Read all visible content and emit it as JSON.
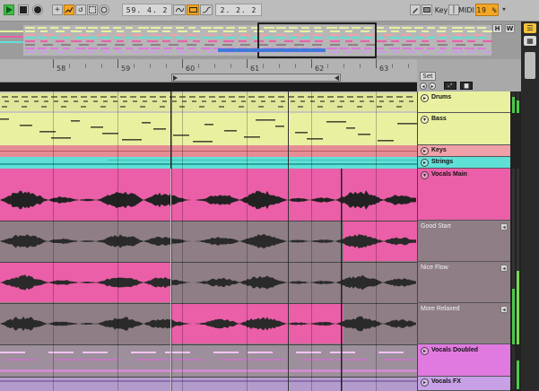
{
  "transport": {
    "play_icon": "play-icon",
    "stop_icon": "stop-icon",
    "record_icon": "record-icon"
  },
  "toolbar": {
    "position": "59.  4.  2",
    "loop_length": "2.  2.  2",
    "key_label": "Key",
    "midi_label": "MIDI",
    "cpu_value": "19 %"
  },
  "overview": {
    "hw_h": "H",
    "hw_w": "W"
  },
  "ruler": {
    "bars": [
      "58",
      "59",
      "60",
      "61",
      "62",
      "63"
    ]
  },
  "set_strip": {
    "set_label": "Set"
  },
  "tracks": [
    {
      "name": "Drums",
      "color": "#e9f1a0"
    },
    {
      "name": "Bass",
      "color": "#e9f1a0"
    },
    {
      "name": "Keys",
      "color": "#f0a0a8"
    },
    {
      "name": "Strings",
      "color": "#5fe0d6"
    },
    {
      "name": "Vocals Main",
      "color": "#ea5fa7"
    },
    {
      "name": "Vocals Doubled",
      "color": "#e07ae0"
    },
    {
      "name": "Vocals FX",
      "color": "#c7a0e6"
    }
  ],
  "takes": [
    {
      "name": "Good Start"
    },
    {
      "name": "Nice Flow"
    },
    {
      "name": "More Relaxed"
    }
  ],
  "colors": {
    "accent_orange": "#f5a623",
    "play_green": "#3fbf4a",
    "vocal_pink": "#ea5fa7",
    "take_gray": "#8f7e86"
  }
}
